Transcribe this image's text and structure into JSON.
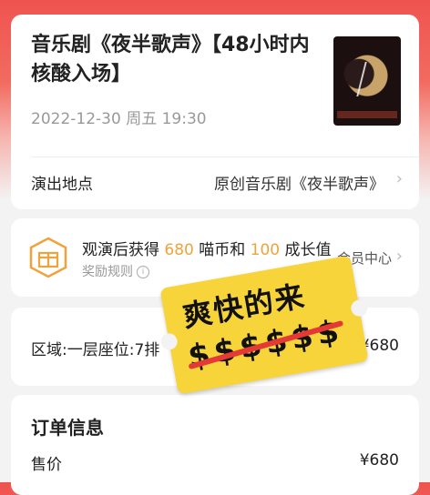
{
  "show": {
    "title": "音乐剧《夜半歌声》【48小时内核酸入场】",
    "datetime": "2022-12-30 周五 19:30",
    "venue_label": "演出地点",
    "venue_value": "原创音乐剧《夜半歌声》"
  },
  "reward": {
    "prefix": "观演后获得 ",
    "coins": "680",
    "middle": " 喵币和 ",
    "growth": "100",
    "suffix": " 成长值",
    "rules_label": "奖励规则",
    "member_center": "会员中心"
  },
  "seat": {
    "label": "区域:一层座位:7排",
    "price": "¥680"
  },
  "order": {
    "title": "订单信息",
    "sale_label": "售价",
    "sale_price": "¥680"
  },
  "sticker": {
    "text": "爽快的来",
    "dollars": "$$$$$$"
  },
  "icons": {
    "chevron": "›",
    "info": "i"
  }
}
